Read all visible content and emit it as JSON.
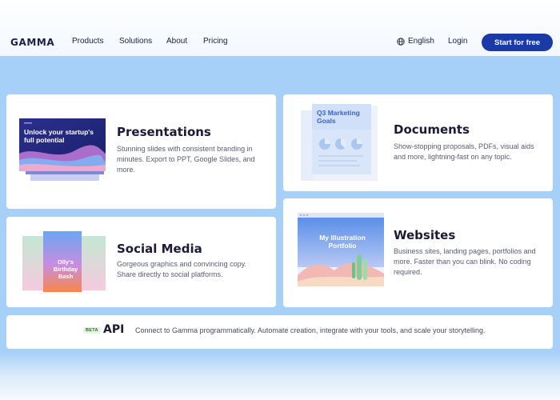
{
  "brand": {
    "logo": "GAMMA"
  },
  "nav": {
    "links": [
      "Products",
      "Solutions",
      "About",
      "Pricing"
    ],
    "language": "English",
    "login": "Login",
    "cta": "Start for free"
  },
  "cards": {
    "presentations": {
      "title": "Presentations",
      "description": "Stunning slides with consistent branding in minutes. Export to PPT, Google Slides, and more.",
      "thumb_text": "Unlock your startup's full potential"
    },
    "documents": {
      "title": "Documents",
      "description": "Show-stopping proposals, PDFs, visual aids and more, lightning-fast on any topic.",
      "thumb_text": "Q3 Marketing Goals"
    },
    "social": {
      "title": "Social Media",
      "description": "Gorgeous graphics and convincing copy. Share directly to social platforms.",
      "thumb_text": "Olly's Birthday Bash"
    },
    "websites": {
      "title": "Websites",
      "description": "Business sites, landing pages, portfolios and more. Faster than you can blink. No coding required.",
      "thumb_text": "My Illustration Portfolio"
    }
  },
  "api": {
    "badge": "BETA",
    "title": "API",
    "description": "Connect to Gamma programmatically. Automate creation, integrate with your tools, and scale your storytelling."
  },
  "colors": {
    "cta": "#1a3aa8",
    "page_bg": "#a6d0f7",
    "card_bg": "#ffffff"
  },
  "icons": [
    "globe-icon"
  ]
}
